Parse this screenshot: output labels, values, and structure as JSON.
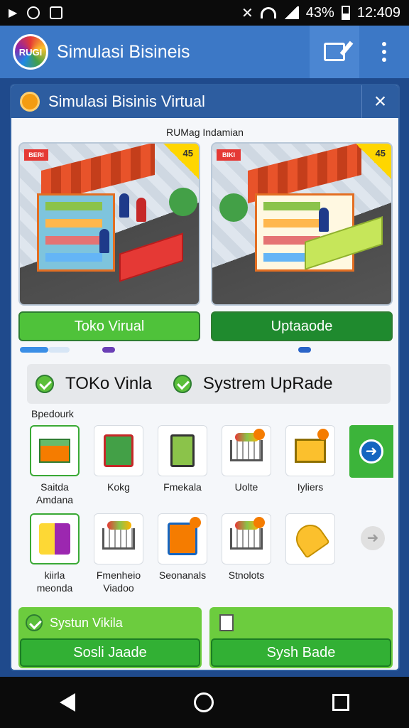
{
  "status_bar": {
    "battery": "43%",
    "time": "12:409"
  },
  "app_bar": {
    "logo_text": "RUGI",
    "title": "Simulasi Bisineis"
  },
  "dialog": {
    "title": "Simulasi Bisinis Virtual",
    "close_label": "×",
    "caption": "RUMag Indamian",
    "cards": [
      {
        "sign": "BERI",
        "corner": "45",
        "button": "Toko Virual",
        "style": "light"
      },
      {
        "sign": "BIKI",
        "corner": "45",
        "button": "Uptaaode",
        "style": "dark"
      }
    ],
    "banner": {
      "left": "TOKo Vinla",
      "right": "Systrem UpRade"
    },
    "section_label": "Bpedourk",
    "items": [
      {
        "icon": "box-icon",
        "label": "Saitda\nAmdana"
      },
      {
        "icon": "register-icon",
        "label": "Kokg"
      },
      {
        "icon": "tablet-icon",
        "label": "Fmekala"
      },
      {
        "icon": "cart-icon",
        "label": "Uolte"
      },
      {
        "icon": "yellow-cart-icon",
        "label": "Iyliers"
      },
      {
        "icon": "bags-icon",
        "label": "kiirla\nmeonda"
      },
      {
        "icon": "cart-icon",
        "label": "Fmenheio\nViadoo"
      },
      {
        "icon": "register-icon",
        "label": "Seonanals"
      },
      {
        "icon": "cart-icon",
        "label": "Stnolots"
      },
      {
        "icon": "cup-icon",
        "label": ""
      }
    ],
    "bottom_cards": [
      {
        "head": "Systun Vikila",
        "button": "Sosli Jaade"
      },
      {
        "head": "",
        "button": "Sysh Bade"
      }
    ]
  },
  "colors": {
    "app_bar": "#3c78c6",
    "accent_green": "#32b034",
    "dialog_header": "#2d5da0"
  }
}
